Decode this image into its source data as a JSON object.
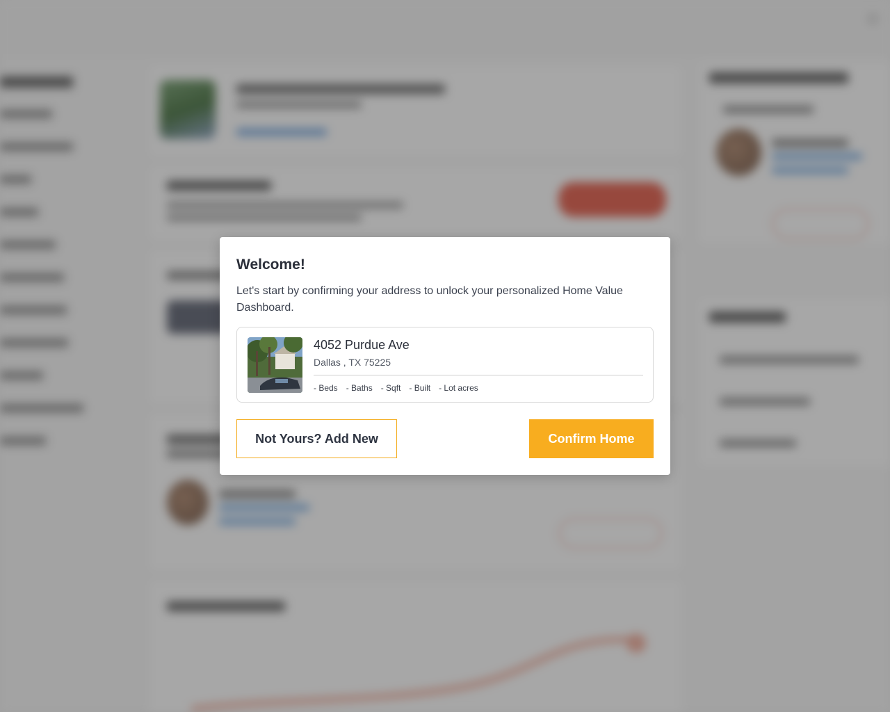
{
  "modal": {
    "title": "Welcome!",
    "subtitle": "Let's start by confirming your address to unlock your personalized Home Value Dashboard.",
    "address": {
      "street": "4052 Purdue Ave",
      "city_line": "Dallas , TX 75225",
      "stats": [
        "- Beds",
        "- Baths",
        "- Sqft",
        "- Built",
        "- Lot acres"
      ]
    },
    "buttons": {
      "add_new": "Not Yours? Add New",
      "confirm": "Confirm Home"
    }
  },
  "colors": {
    "accent": "#f8ad1f",
    "overlay": "rgba(60,60,60,0.45)",
    "text_dark": "#2b2f3a"
  },
  "icons": {
    "house_photo": "house-photo-icon"
  }
}
